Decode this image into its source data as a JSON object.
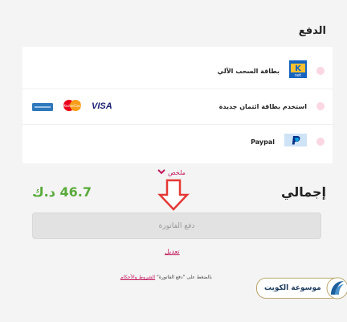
{
  "page": {
    "title": "الدفع"
  },
  "payment_methods": [
    {
      "label": "بطاقة السحب الآلي",
      "icon": "knet-logo-icon"
    },
    {
      "label": "استخدم بطاقة ائتمان جديدة",
      "logos": [
        "visa-logo-icon",
        "mastercard-logo-icon",
        "amex-logo-icon"
      ],
      "visa_text": "VISA",
      "mastercard_text": "MasterCard"
    },
    {
      "label": "Paypal",
      "icon": "paypal-logo-icon"
    }
  ],
  "summary": {
    "link_label": "ملخص"
  },
  "total": {
    "label": "إجمالي",
    "amount": "46.7 د.ك"
  },
  "pay_button": {
    "label": "دفع الفاتورة"
  },
  "edit": {
    "label": "تعديل"
  },
  "terms": {
    "prefix": "بالضغط على \"دفع الفاتورة\"",
    "link": "الشروط والأحكام"
  },
  "watermark": {
    "text": "موسوعة الكويت"
  },
  "colors": {
    "accent": "#c2185b",
    "total": "#5aab3b",
    "radio": "#fad7e2",
    "arrow": "#e53935"
  }
}
